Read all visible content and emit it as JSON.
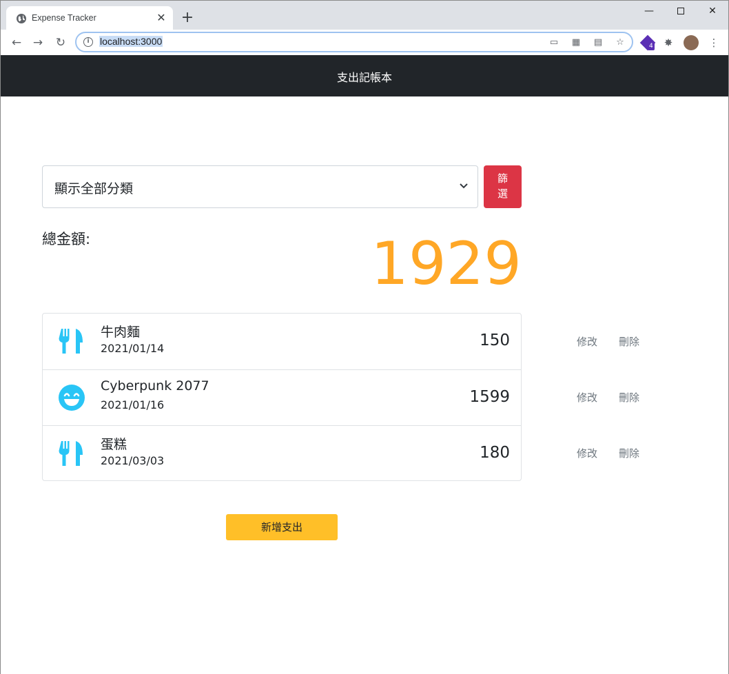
{
  "browser": {
    "tab_title": "Expense Tracker",
    "url": "localhost:3000",
    "extension_badge": "4"
  },
  "app": {
    "brand": "支出記帳本"
  },
  "filter": {
    "selected": "顯示全部分類",
    "button_label": "篩選"
  },
  "summary": {
    "total_label": "總金額:",
    "total_amount": "1929"
  },
  "records": [
    {
      "icon": "utensils-icon",
      "name": "牛肉麵",
      "date": "2021/01/14",
      "amount": "150"
    },
    {
      "icon": "grin-icon",
      "name": "Cyberpunk 2077",
      "date": "2021/01/16",
      "amount": "1599"
    },
    {
      "icon": "utensils-icon",
      "name": "蛋糕",
      "date": "2021/03/03",
      "amount": "180"
    }
  ],
  "actions": {
    "edit_label": "修改",
    "delete_label": "刪除"
  },
  "add_button": "新增支出",
  "colors": {
    "navbar": "#212529",
    "filter_button": "#dc3545",
    "total_amount": "#ffa726",
    "icon": "#29c5f6",
    "add_button": "#ffbf28"
  }
}
